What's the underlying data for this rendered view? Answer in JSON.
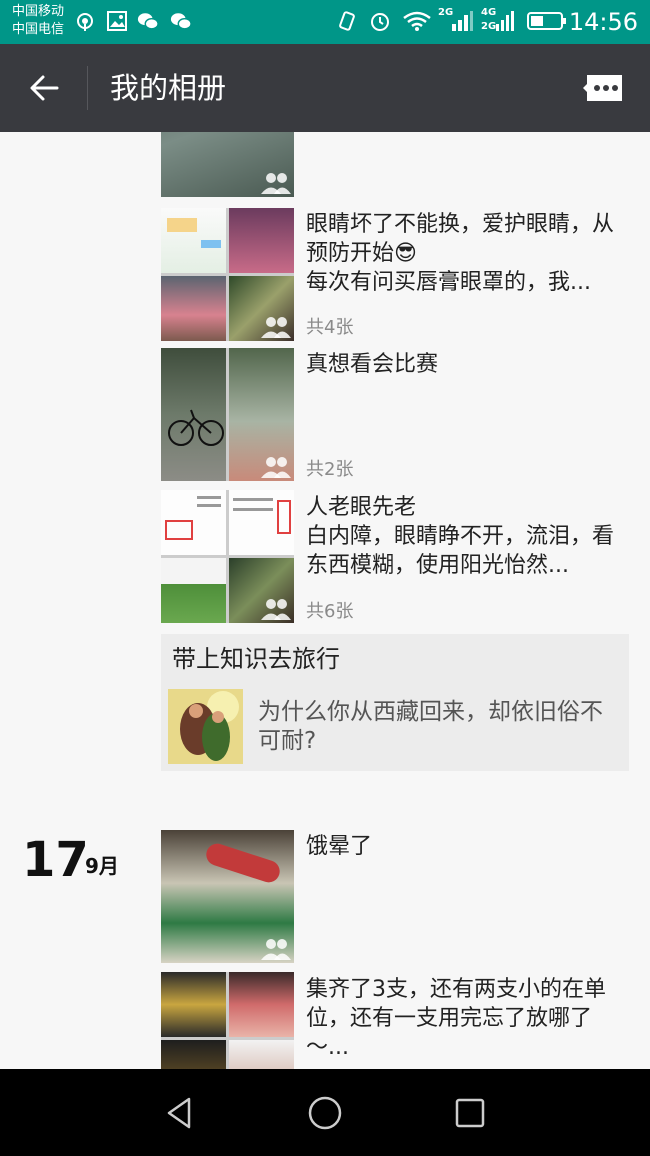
{
  "status_bar": {
    "carrier_1": "中国移动",
    "carrier_2": "中国电信",
    "network_1": "2G",
    "network_2a": "4G",
    "network_2b": "2G",
    "time": "14:56"
  },
  "header": {
    "title": "我的相册"
  },
  "posts": [
    {
      "text": "",
      "count": ""
    },
    {
      "text": "眼睛坏了不能换，爱护眼睛，从预防开始😎\n每次有问买唇膏眼罩的，我...",
      "count": "共4张"
    },
    {
      "text": "真想看会比赛",
      "count": "共2张"
    },
    {
      "text": "人老眼先老\n白内障，眼睛睁不开，流泪，看东西模糊，使用阳光怡然...",
      "count": "共6张"
    }
  ],
  "share_card": {
    "title": "带上知识去旅行",
    "description": "为什么你从西藏回来，却依旧俗不可耐?"
  },
  "date_group": {
    "day": "17",
    "month": "9月"
  },
  "posts_2": [
    {
      "text": "饿晕了"
    },
    {
      "text": "集齐了3支，还有两支小的在单位，还有一支用完忘了放哪了～..."
    }
  ],
  "colors": {
    "status_bar": "#009688",
    "title_bar": "#393a3f",
    "background": "#f7f7f7",
    "share_card": "#ececec"
  }
}
